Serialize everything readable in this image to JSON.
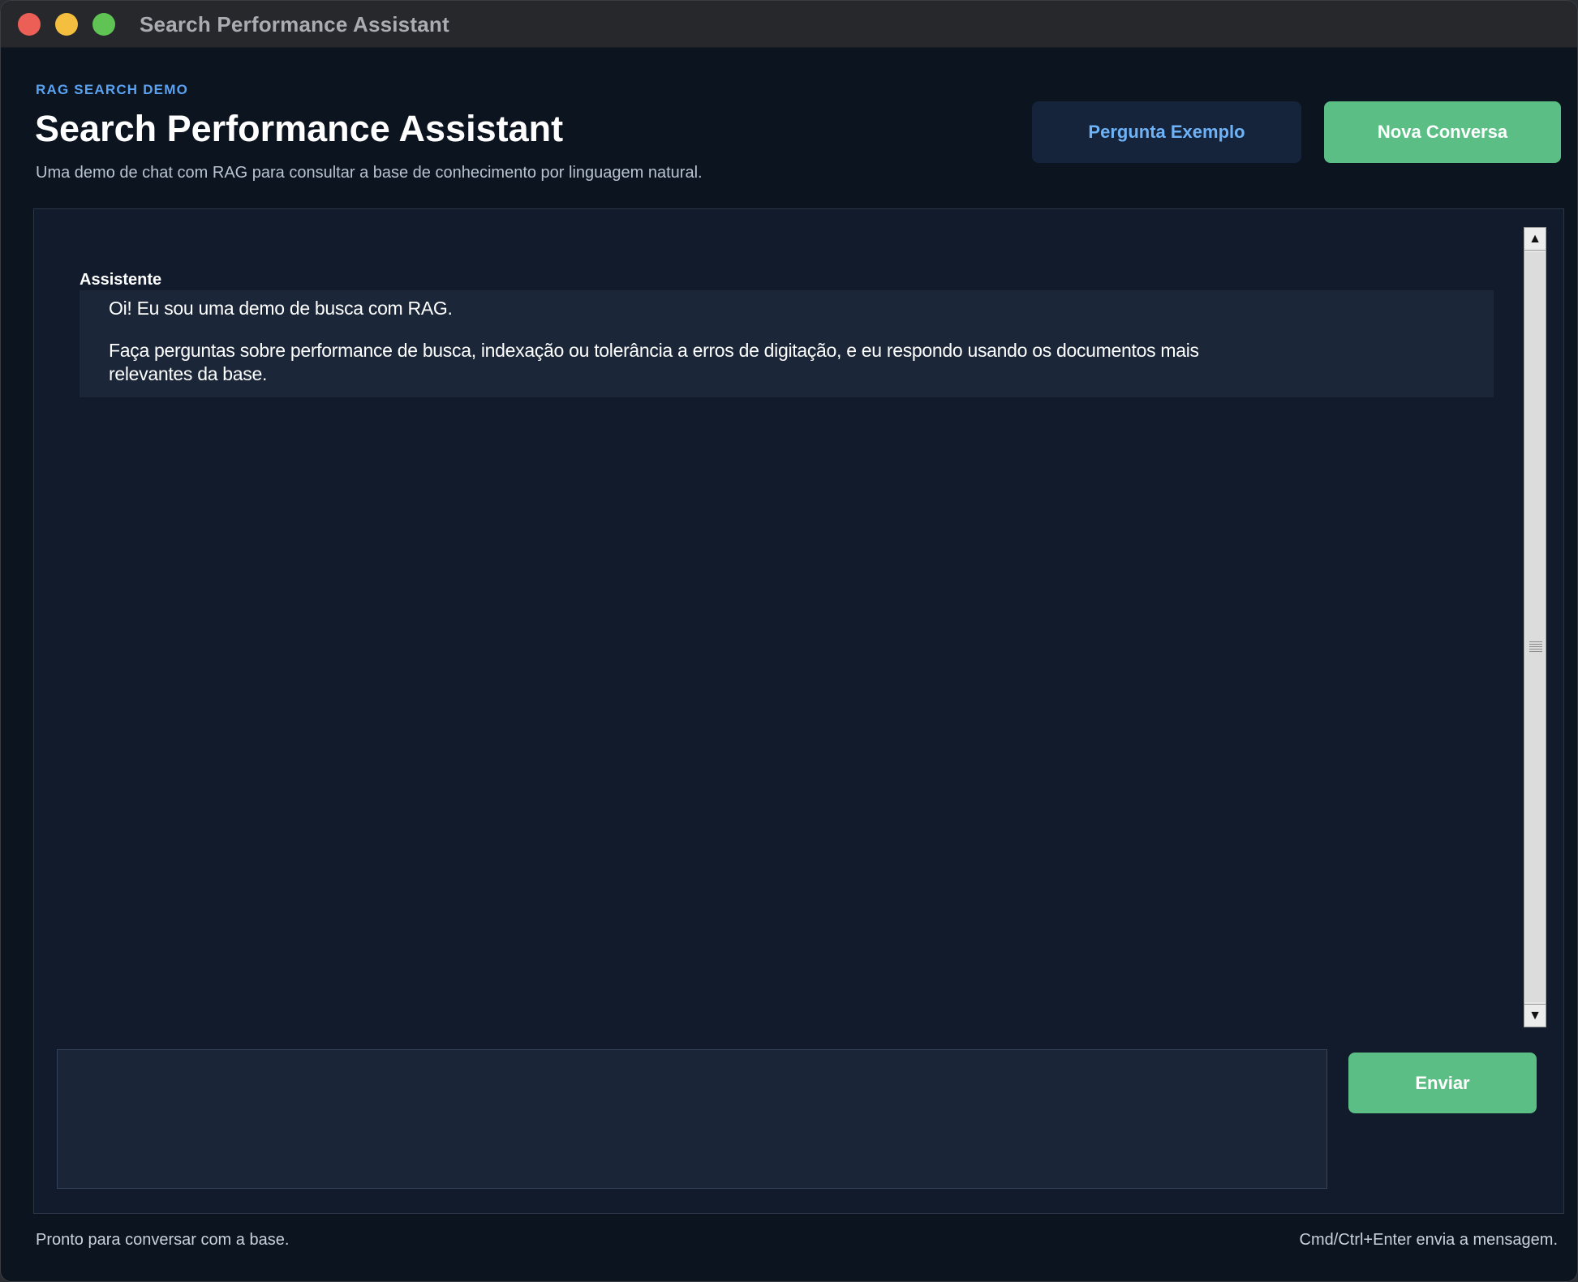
{
  "window": {
    "title": "Search Performance Assistant"
  },
  "header": {
    "eyebrow": "RAG SEARCH DEMO",
    "title": "Search Performance Assistant",
    "subtitle": "Uma demo de chat com RAG para consultar a base de conhecimento por linguagem natural.",
    "example_button": "Pergunta Exemplo",
    "new_chat_button": "Nova Conversa"
  },
  "chat": {
    "messages": [
      {
        "author": "Assistente",
        "paragraphs": [
          "Oi! Eu sou uma demo de busca com RAG.",
          "Faça perguntas sobre performance de busca, indexação ou tolerância a erros de digitação, e eu respondo usando os documentos mais relevantes da base."
        ]
      }
    ],
    "input_value": "",
    "send_button": "Enviar"
  },
  "status": {
    "left": "Pronto para conversar com a base.",
    "right": "Cmd/Ctrl+Enter envia a mensagem."
  },
  "colors": {
    "background": "#0c1420",
    "panel": "#111b2b",
    "accent_green": "#5bbf85",
    "accent_blue": "#5aa3f2"
  },
  "icons": {
    "scroll_up": "▲",
    "scroll_down": "▼"
  }
}
